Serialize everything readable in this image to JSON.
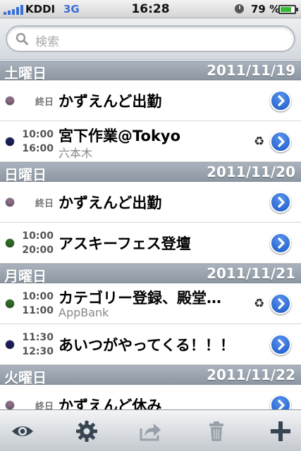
{
  "status": {
    "carrier": "KDDI",
    "network": "3G",
    "time": "16:28",
    "battery": "79 %",
    "battery_level": 0.79
  },
  "search": {
    "placeholder": "検索"
  },
  "days": [
    {
      "name": "土曜日",
      "date": "2011/11/19",
      "events": [
        {
          "allday": "終日",
          "title": "かずえんど出勤",
          "color": "#8a6b86"
        },
        {
          "start": "10:00",
          "end": "16:00",
          "title": "宮下作業@Tokyo",
          "subtitle": "六本木",
          "recurring": true,
          "color": "#1b1f5a"
        }
      ]
    },
    {
      "name": "日曜日",
      "date": "2011/11/20",
      "events": [
        {
          "allday": "終日",
          "title": "かずえんど出勤",
          "color": "#8a6b86"
        },
        {
          "start": "10:00",
          "end": "20:00",
          "title": "アスキーフェス登壇",
          "color": "#2e6b25"
        }
      ]
    },
    {
      "name": "月曜日",
      "date": "2011/11/21",
      "events": [
        {
          "start": "10:00",
          "end": "11:00",
          "title": "カテゴリー登録、殿堂…",
          "subtitle": "AppBank",
          "recurring": true,
          "color": "#2e6b25"
        },
        {
          "start": "11:30",
          "end": "12:30",
          "title": "あいつがやってくる！！！",
          "color": "#1b1f5a"
        }
      ]
    },
    {
      "name": "火曜日",
      "date": "2011/11/22",
      "events": [
        {
          "allday": "終日",
          "title": "かずえんど休み",
          "color": "#8a6b86"
        }
      ]
    }
  ],
  "toolbar": {
    "icons": [
      "eye-icon",
      "gear-icon",
      "share-icon",
      "trash-icon",
      "plus-icon"
    ]
  }
}
